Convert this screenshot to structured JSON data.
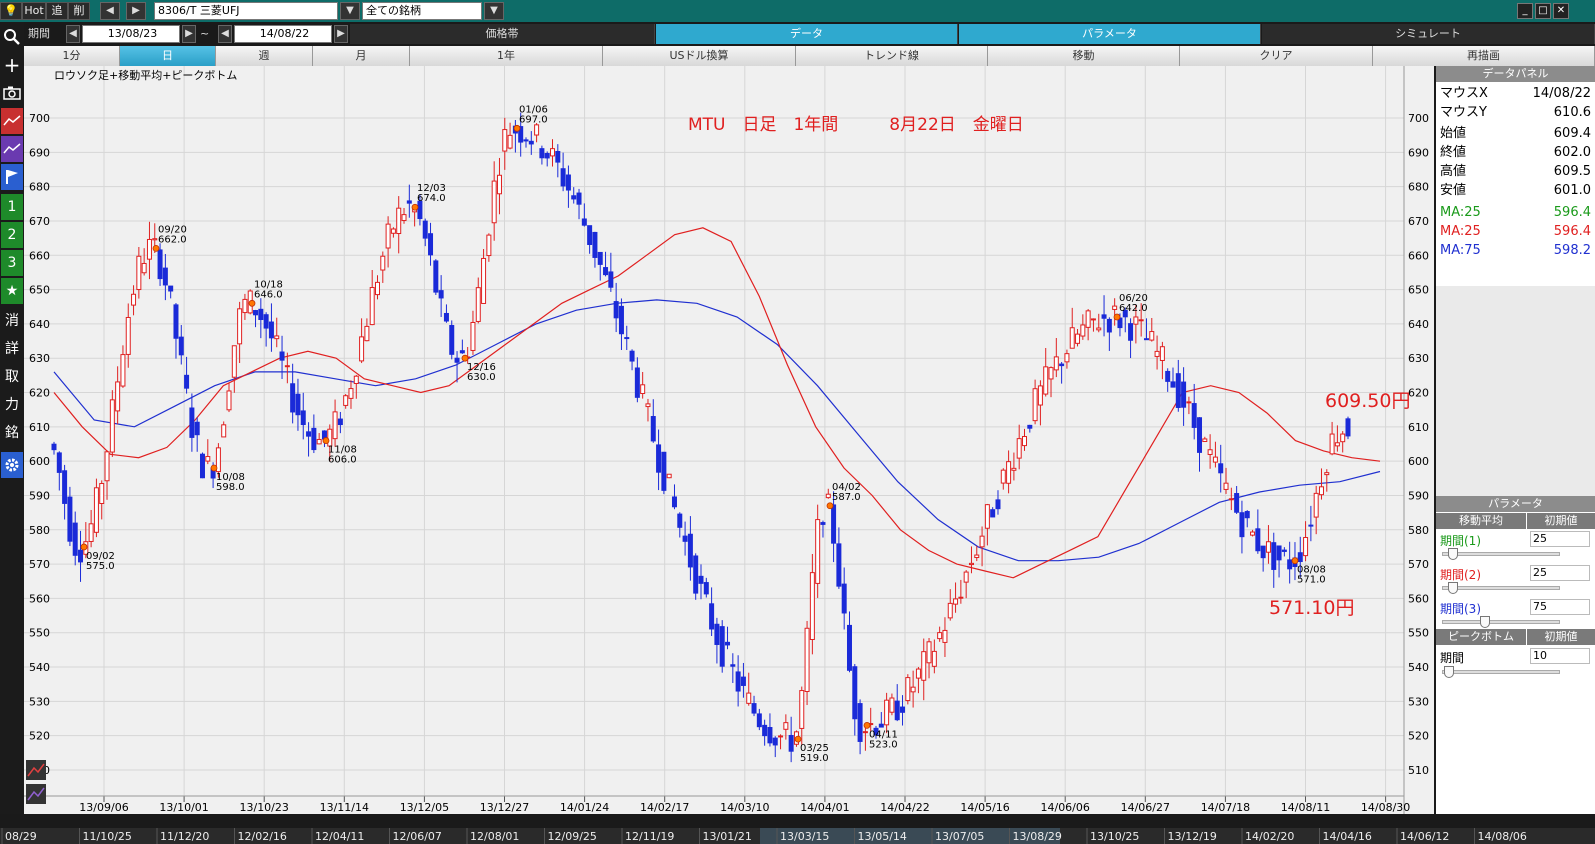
{
  "toolbar": {
    "hot": "Hot",
    "tsui": "追",
    "sakujo": "削",
    "prev": "◀",
    "next": "▶",
    "symbol": "8306/T 三菱UFJ",
    "dropdown": "▼",
    "filter": "全ての銘柄",
    "min": "_",
    "max": "□",
    "close": "✕"
  },
  "period": {
    "label": "期間",
    "from": "13/08/23",
    "tilde": "~",
    "to": "14/08/22",
    "tabs": [
      {
        "label": "価格帯",
        "active": false
      },
      {
        "label": "データ",
        "active": true
      },
      {
        "label": "パラメータ",
        "active": true
      },
      {
        "label": "シミュレート",
        "active": false
      }
    ]
  },
  "timeframe": {
    "tabs": [
      {
        "label": "1分",
        "active": false
      },
      {
        "label": "日",
        "active": true
      },
      {
        "label": "週",
        "active": false
      },
      {
        "label": "月",
        "active": false
      },
      {
        "label": "1年",
        "active": false
      },
      {
        "label": "USドル換算",
        "active": false
      },
      {
        "label": "トレンド線",
        "active": false
      },
      {
        "label": "移動",
        "active": false
      },
      {
        "label": "クリア",
        "active": false
      },
      {
        "label": "再描画",
        "active": false
      }
    ]
  },
  "left_tools": [
    "search-icon",
    "crosshair-icon",
    "camera-icon",
    "chart-red-icon",
    "chart-purple-icon",
    "flag-icon",
    "1",
    "2",
    "3",
    "★",
    "消",
    "詳",
    "取",
    "力",
    "銘",
    "gear-icon"
  ],
  "data_panel": {
    "title": "データパネル",
    "rows": [
      {
        "k": "マウスX",
        "v": "14/08/22"
      },
      {
        "k": "マウスY",
        "v": "610.6"
      },
      {
        "k": "始値",
        "v": "609.4"
      },
      {
        "k": "終値",
        "v": "602.0"
      },
      {
        "k": "高値",
        "v": "609.5"
      },
      {
        "k": "安値",
        "v": "601.0"
      }
    ],
    "ma_rows": [
      {
        "k": "MA:25",
        "v": "596.4",
        "color": "#1a9a1a"
      },
      {
        "k": "MA:25",
        "v": "596.4",
        "color": "#e02020"
      },
      {
        "k": "MA:75",
        "v": "598.2",
        "color": "#2030d0"
      }
    ]
  },
  "param_panel": {
    "title": "パラメータ",
    "ma_head": "移動平均",
    "init": "初期値",
    "params": [
      {
        "label": "期間(1)",
        "value": "25",
        "color": "#1a9a1a"
      },
      {
        "label": "期間(2)",
        "value": "25",
        "color": "#e02020"
      },
      {
        "label": "期間(3)",
        "value": "75",
        "color": "#2030d0"
      }
    ],
    "pb_head": "ピークボトム",
    "pb_init": "初期値",
    "pb_label": "期間",
    "pb_value": "10"
  },
  "chart_data": {
    "type": "candlestick",
    "title": "ロウソク足+移動平均+ピークボトム",
    "annotation": "MTU　日足　1年間　　　8月22日　金曜日",
    "ylim": [
      505,
      710
    ],
    "yticks": [
      510,
      520,
      530,
      540,
      550,
      560,
      570,
      580,
      590,
      600,
      610,
      620,
      630,
      640,
      650,
      660,
      670,
      680,
      690,
      700
    ],
    "xticks": [
      "13/09/06",
      "13/10/01",
      "13/10/23",
      "13/11/14",
      "13/12/05",
      "13/12/27",
      "14/01/24",
      "14/02/17",
      "14/03/10",
      "14/04/01",
      "14/04/22",
      "14/05/16",
      "14/06/06",
      "14/06/27",
      "14/07/18",
      "14/08/11",
      "14/08/30"
    ],
    "bottom_dates": [
      "08/29",
      "11/10/25",
      "11/12/20",
      "12/02/16",
      "12/04/11",
      "12/06/07",
      "12/08/01",
      "12/09/25",
      "12/11/19",
      "13/01/21",
      "13/03/15",
      "13/05/14",
      "13/07/05",
      "13/08/29",
      "13/10/25",
      "13/12/19",
      "14/02/20",
      "14/04/16",
      "14/06/12",
      "14/08/06"
    ],
    "peaks": [
      {
        "date": "09/02",
        "value": 575.0,
        "type": "bottom"
      },
      {
        "date": "09/20",
        "value": 662.0,
        "type": "peak"
      },
      {
        "date": "10/08",
        "value": 598.0,
        "type": "bottom"
      },
      {
        "date": "10/18",
        "value": 646.0,
        "type": "peak"
      },
      {
        "date": "11/08",
        "value": 606.0,
        "type": "bottom"
      },
      {
        "date": "12/03",
        "value": 674.0,
        "type": "peak"
      },
      {
        "date": "12/16",
        "value": 630.0,
        "type": "bottom"
      },
      {
        "date": "01/06",
        "value": 697.0,
        "type": "peak"
      },
      {
        "date": "03/25",
        "value": 519.0,
        "type": "bottom"
      },
      {
        "date": "04/02",
        "value": 587.0,
        "type": "peak"
      },
      {
        "date": "04/11",
        "value": 523.0,
        "type": "bottom"
      },
      {
        "date": "06/20",
        "value": 642.0,
        "type": "peak"
      },
      {
        "date": "08/08",
        "value": 571.0,
        "type": "bottom"
      }
    ],
    "callouts": [
      {
        "text": "609.50円",
        "value": 609.5
      },
      {
        "text": "571.10円",
        "value": 571.1
      }
    ],
    "ma_short": [
      620,
      610,
      602,
      601,
      604,
      612,
      622,
      626,
      630,
      632,
      630,
      624,
      622,
      620,
      622,
      628,
      634,
      640,
      646,
      650,
      654,
      660,
      666,
      668,
      664,
      648,
      628,
      610,
      598,
      590,
      580,
      574,
      570,
      568,
      566,
      570,
      574,
      578,
      592,
      606,
      620,
      622,
      620,
      614,
      606,
      603,
      601,
      600
    ],
    "ma_long": [
      626,
      612,
      610,
      616,
      622,
      626,
      626,
      624,
      622,
      624,
      628,
      634,
      640,
      644,
      646,
      647,
      646,
      642,
      634,
      622,
      608,
      594,
      583,
      575,
      571,
      571,
      572,
      576,
      582,
      588,
      591,
      593,
      594,
      597
    ]
  }
}
